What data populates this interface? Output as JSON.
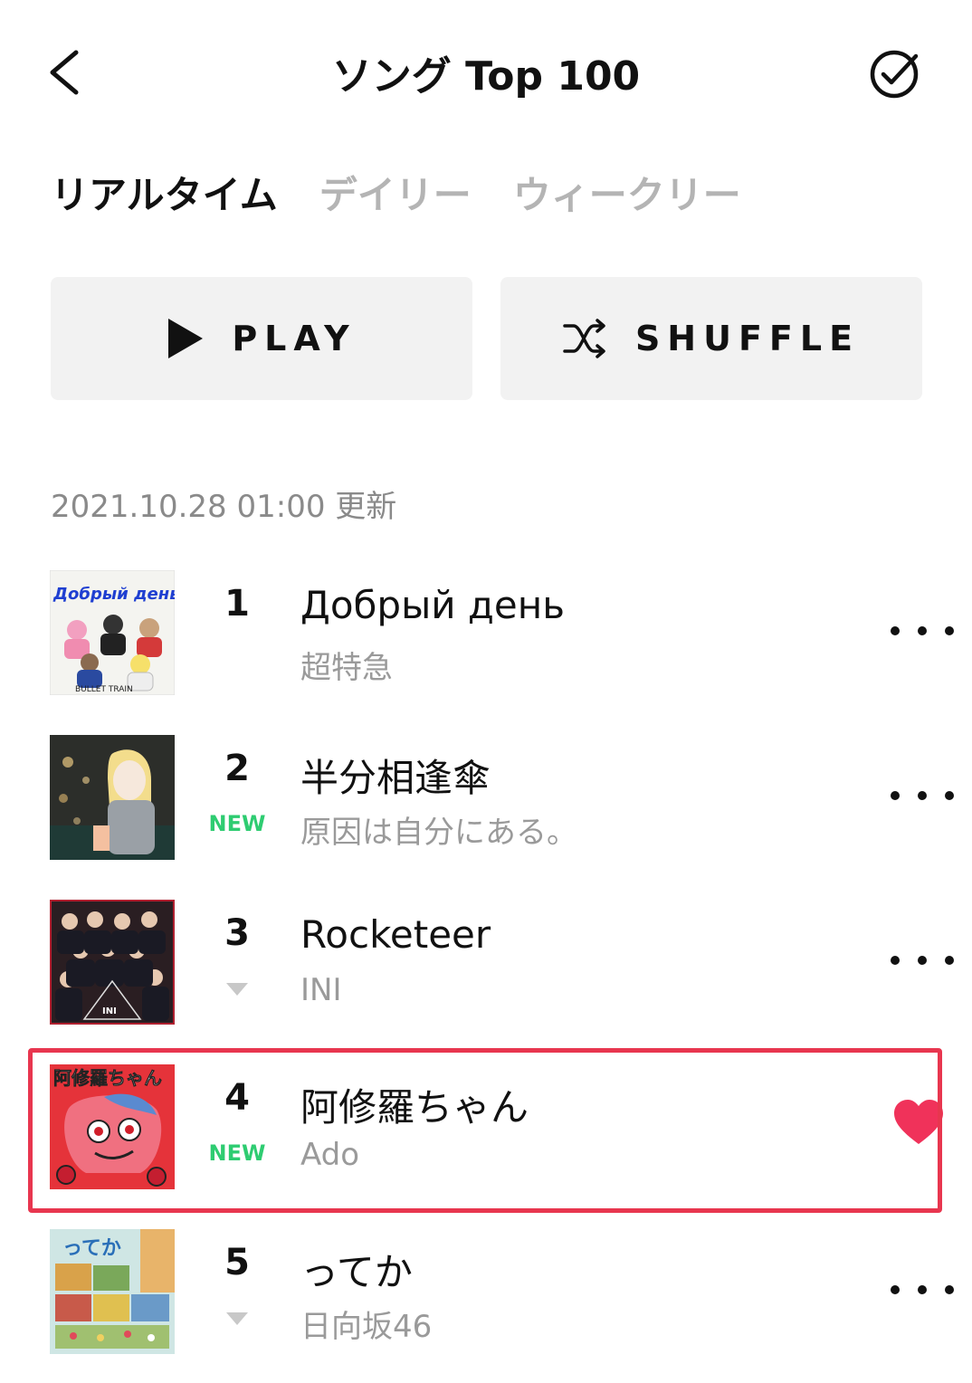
{
  "header": {
    "title": "ソング Top 100",
    "back_icon": "chevron-left-icon",
    "check_icon": "check-circle-icon"
  },
  "tabs": [
    {
      "label": "リアルタイム",
      "active": true
    },
    {
      "label": "デイリー",
      "active": false
    },
    {
      "label": "ウィークリー",
      "active": false
    }
  ],
  "actions": {
    "play_label": "PLAY",
    "shuffle_label": "SHUFFLE"
  },
  "update_text": "2021.10.28 01:00 更新",
  "songs": [
    {
      "rank": "1",
      "title": "Добрый день",
      "artist": "超特急",
      "status": "",
      "liked": false,
      "cover_text": "Добрый день"
    },
    {
      "rank": "2",
      "title": "半分相逢傘",
      "artist": "原因は自分にある。",
      "status": "NEW",
      "liked": false,
      "cover_text": ""
    },
    {
      "rank": "3",
      "title": "Rocketeer",
      "artist": "INI",
      "status": "down",
      "liked": false,
      "cover_text": "INI"
    },
    {
      "rank": "4",
      "title": "阿修羅ちゃん",
      "artist": "Ado",
      "status": "NEW",
      "liked": true,
      "cover_text": "阿修羅ちゃん"
    },
    {
      "rank": "5",
      "title": "ってか",
      "artist": "日向坂46",
      "status": "down",
      "liked": false,
      "cover_text": "ってか"
    }
  ],
  "colors": {
    "new_badge": "#2ecc71",
    "highlight": "#e8364f",
    "heart": "#f0325a",
    "inactive_tab": "#b4b4b4"
  }
}
